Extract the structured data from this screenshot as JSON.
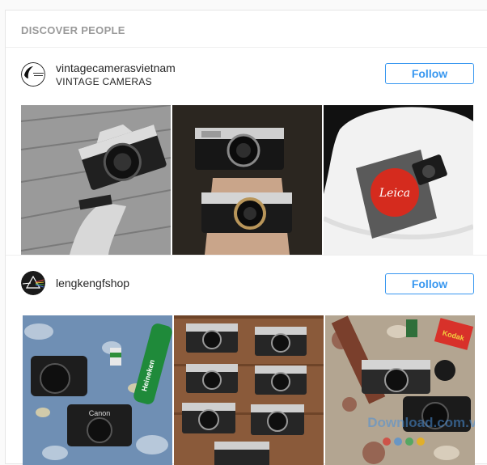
{
  "header": {
    "title": "DISCOVER PEOPLE"
  },
  "suggestions": [
    {
      "username": "vintagecamerasvietnam",
      "full_name": "VINTAGE CAMERAS",
      "follow_label": "Follow",
      "avatar_text": "VINTAGE CAMERAS",
      "photos": [
        {
          "description": "hand-holding-pentax-camera"
        },
        {
          "description": "two-olympus-rangefinders"
        },
        {
          "description": "leica-card-on-white-chair"
        }
      ]
    },
    {
      "username": "lengkengfshop",
      "full_name": "",
      "follow_label": "Follow",
      "photos": [
        {
          "description": "canon-cameras-with-heineken"
        },
        {
          "description": "grid-of-rangefinders"
        },
        {
          "description": "cameras-with-film-boxes"
        }
      ]
    }
  ],
  "photo_text": {
    "leica_logo": "Leica",
    "heineken": "Heineken",
    "canon": "Canon",
    "film_box": "Kodak"
  },
  "watermark": {
    "text": "Download.com.vn"
  },
  "colors": {
    "accent": "#3897f0",
    "header_text": "#999999",
    "text": "#262626",
    "leica_red": "#d52b1e",
    "heineken_green": "#1f8a3a"
  }
}
